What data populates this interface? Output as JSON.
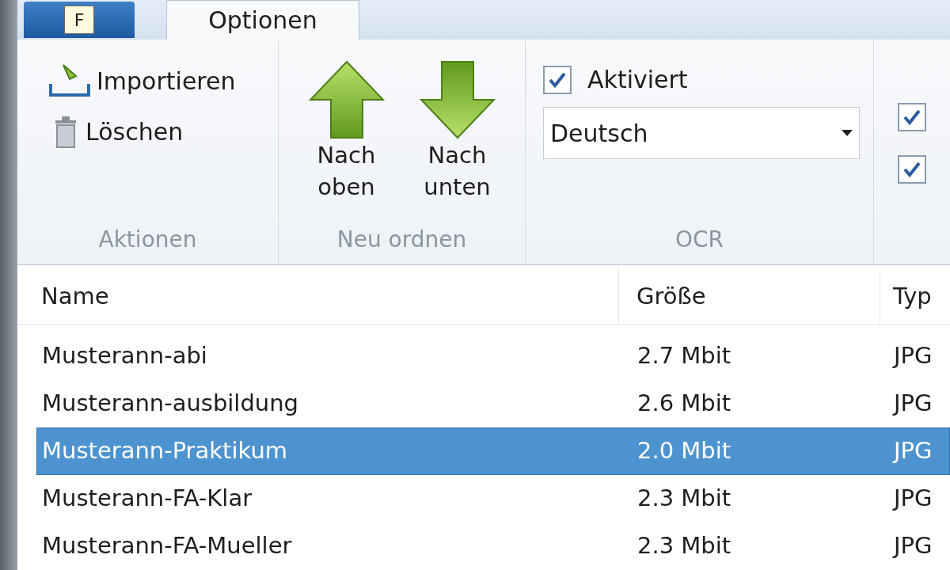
{
  "file_button": {
    "label": "F"
  },
  "tabs": [
    {
      "label": "Optionen",
      "selected": true
    }
  ],
  "ribbon": {
    "actions": {
      "label": "Aktionen",
      "import": "Importieren",
      "delete": "Löschen"
    },
    "reorder": {
      "label": "Neu ordnen",
      "up": "Nach oben",
      "down": "Nach unten"
    },
    "ocr": {
      "label": "OCR",
      "enabled": {
        "label": "Aktiviert",
        "checked": true
      },
      "language": "Deutsch"
    },
    "extra": {
      "checkboxes": [
        {
          "checked": true
        },
        {
          "checked": true
        }
      ]
    }
  },
  "table": {
    "columns": [
      "Name",
      "Größe",
      "Typ"
    ],
    "rows": [
      {
        "name": "Musterann-abi",
        "size": "2.7 Mbit",
        "type": "JPG",
        "selected": false
      },
      {
        "name": "Musterann-ausbildung",
        "size": "2.6 Mbit",
        "type": "JPG",
        "selected": false
      },
      {
        "name": "Musterann-Praktikum",
        "size": "2.0 Mbit",
        "type": "JPG",
        "selected": true
      },
      {
        "name": "Musterann-FA-Klar",
        "size": "2.3 Mbit",
        "type": "JPG",
        "selected": false
      },
      {
        "name": "Musterann-FA-Mueller",
        "size": "2.3 Mbit",
        "type": "JPG",
        "selected": false
      }
    ]
  }
}
